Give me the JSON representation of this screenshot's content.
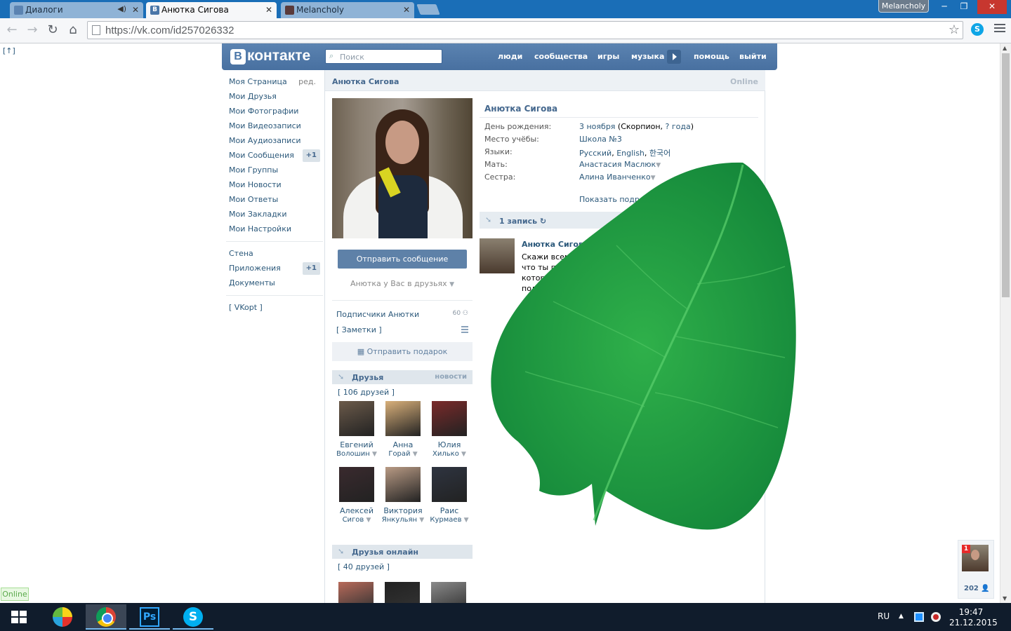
{
  "browser": {
    "tabs": [
      {
        "label": "Диалоги"
      },
      {
        "label": "Анютка Сигова"
      },
      {
        "label": "Melancholy"
      }
    ],
    "profile_name": "Melancholy",
    "url": "https://vk.com/id257026332",
    "window_buttons": {
      "minimize": "─",
      "restore": "❐",
      "close": "✕"
    }
  },
  "page": {
    "vkopt_corner": "[↑]",
    "online_tag": "Online"
  },
  "vk_header": {
    "logo_letter": "В",
    "logo_text": "контакте",
    "search_placeholder": "Поиск",
    "nav": [
      "люди",
      "сообщества",
      "игры",
      "музыка",
      "помощь",
      "выйти"
    ]
  },
  "left_menu": {
    "items": [
      {
        "label": "Моя Страница",
        "extra": "ред."
      },
      {
        "label": "Мои Друзья"
      },
      {
        "label": "Мои Фотографии"
      },
      {
        "label": "Мои Видеозаписи"
      },
      {
        "label": "Мои Аудиозаписи"
      },
      {
        "label": "Мои Сообщения",
        "count": "+1"
      },
      {
        "label": "Мои Группы"
      },
      {
        "label": "Мои Новости"
      },
      {
        "label": "Мои Ответы"
      },
      {
        "label": "Мои Закладки"
      },
      {
        "label": "Мои Настройки"
      }
    ],
    "items2": [
      {
        "label": "Стена"
      },
      {
        "label": "Приложения",
        "count": "+1"
      },
      {
        "label": "Документы"
      }
    ],
    "vkopt": "[ VKopt ]"
  },
  "profile": {
    "header_name": "Анютка Сигова",
    "status": "Online",
    "send_message": "Отправить сообщение",
    "friendship": "Анютка у Вас в друзьях",
    "subscribers_label": "Подписчики Анютки",
    "subscribers_count": "60",
    "notes": "[ Заметки ]",
    "gift": "Отправить подарок",
    "friends_title": "Друзья",
    "friends_news": "новости",
    "friends_count": "[ 106 друзей ]",
    "friends": [
      {
        "first": "Евгений",
        "last": "Волошин",
        "color": "#6b5a4a"
      },
      {
        "first": "Анна",
        "last": "Горай",
        "color": "#d9b07a"
      },
      {
        "first": "Юлия",
        "last": "Хилько",
        "color": "#7a2a2a"
      },
      {
        "first": "Алексей",
        "last": "Сигов",
        "color": "#3a2a2e"
      },
      {
        "first": "Виктория",
        "last": "Янкульян",
        "color": "#b89a84"
      },
      {
        "first": "Раис",
        "last": "Курмаев",
        "color": "#2e3440"
      }
    ],
    "online_title": "Друзья онлайн",
    "online_count": "[ 40 друзей ]",
    "online_friend_colors": [
      "#b86a5a",
      "#222222",
      "#8a8a8a"
    ]
  },
  "info": {
    "name": "Анютка Сигова",
    "rows": [
      {
        "label": "День рождения:",
        "link1": "3 ноября",
        "text1": " (Скорпион, ",
        "link2": "? года",
        "text2": ")"
      },
      {
        "label": "Место учёбы:",
        "link1": "Школа №3"
      },
      {
        "label": "Языки:",
        "link1": "Русский",
        "text1": ", ",
        "link2": "English",
        "text2": ", ",
        "link3": "한국어"
      },
      {
        "label": "Мать:",
        "link1": "Анастасия Маслюк",
        "dropdown": "▼"
      },
      {
        "label": "Сестра:",
        "link1": "Алина Иванченко",
        "dropdown": "▼"
      }
    ],
    "show_more": "Показать подробную"
  },
  "wall": {
    "title": "1 запись ↻",
    "author": "Анютка Сигова",
    "text_lines": [
      "Скажи всем,",
      "что ты по",
      "которы",
      "под"
    ]
  },
  "fastchat": {
    "badge": "1",
    "count": "202"
  },
  "taskbar": {
    "lang": "RU",
    "time": "19:47",
    "date": "21.12.2015",
    "ps_label": "Ps",
    "skype_label": "S"
  },
  "colors": {
    "vk_blue": "#4a76a8",
    "link": "#2b587a",
    "leaf": "#1f9a3c"
  }
}
